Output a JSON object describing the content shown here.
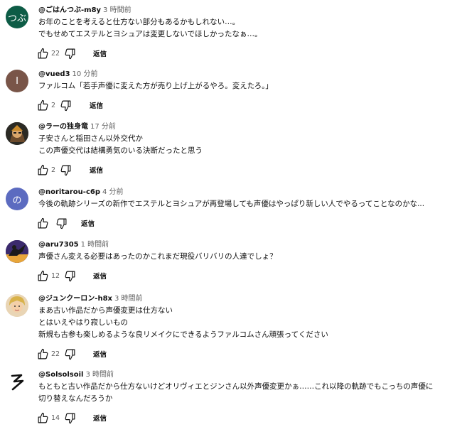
{
  "comments": [
    {
      "handle": "@ごはんつぶ-m8y",
      "time": "3 時間前",
      "lines": [
        "お年のことを考えると仕方ない部分もあるかもしれない…。",
        "でもせめてエステルとヨシュアは変更しないでほしかったなぁ…。"
      ],
      "likes": "22",
      "reply_label": "返信",
      "avatar": {
        "kind": "text",
        "text": "つぶ",
        "bg": "#0d5c46"
      }
    },
    {
      "handle": "@vued3",
      "time": "10 分前",
      "lines": [
        "ファルコム「若手声優に変えた方が売り上げ上がるやろ。変えたろ。」"
      ],
      "likes": "2",
      "reply_label": "返信",
      "avatar": {
        "kind": "text",
        "text": "I",
        "bg": "#795548"
      }
    },
    {
      "handle": "@ラーの独身竜",
      "time": "17 分前",
      "lines": [
        "子安さんと稲田さん以外交代か",
        "この声優交代は結構勇気のいる決断だったと思う"
      ],
      "likes": "2",
      "reply_label": "返信",
      "avatar": {
        "kind": "image",
        "bg": "#2b2a24"
      }
    },
    {
      "handle": "@noritarou-c6p",
      "time": "4 分前",
      "lines": [
        "今後の軌跡シリーズの新作でエステルとヨシュアが再登場しても声優はやっぱり新しい人でやるってことなのかな..."
      ],
      "likes": "",
      "reply_label": "返信",
      "avatar": {
        "kind": "text",
        "text": "の",
        "bg": "#5c6bc0"
      }
    },
    {
      "handle": "@aru7305",
      "time": "1 時間前",
      "lines": [
        "声優さん変える必要はあったのかこれまだ現役バリバリの人達でしょ？"
      ],
      "likes": "12",
      "reply_label": "返信",
      "avatar": {
        "kind": "image",
        "bg": "#3b2a6d"
      }
    },
    {
      "handle": "@ジュンクーロン-h8x",
      "time": "3 時間前",
      "lines": [
        "まあ古い作品だから声優変更は仕方ない",
        "とはいえやはり寂しいもの",
        "新規も古参も楽しめるような良リメイクにできるようファルコムさん頑張ってください"
      ],
      "likes": "22",
      "reply_label": "返信",
      "avatar": {
        "kind": "image",
        "bg": "#e9d5b5"
      }
    },
    {
      "handle": "@Solsolsoil",
      "time": "3 時間前",
      "lines": [
        "もともと古い作品だから仕方ないけどオリヴィエとジンさん以外声優変更かぁ……これ以降の軌跡でもこっちの声優に",
        "切り替えなんだろうか"
      ],
      "likes": "14",
      "reply_label": "返信",
      "avatar": {
        "kind": "image",
        "bg": "#ffffff"
      }
    }
  ]
}
